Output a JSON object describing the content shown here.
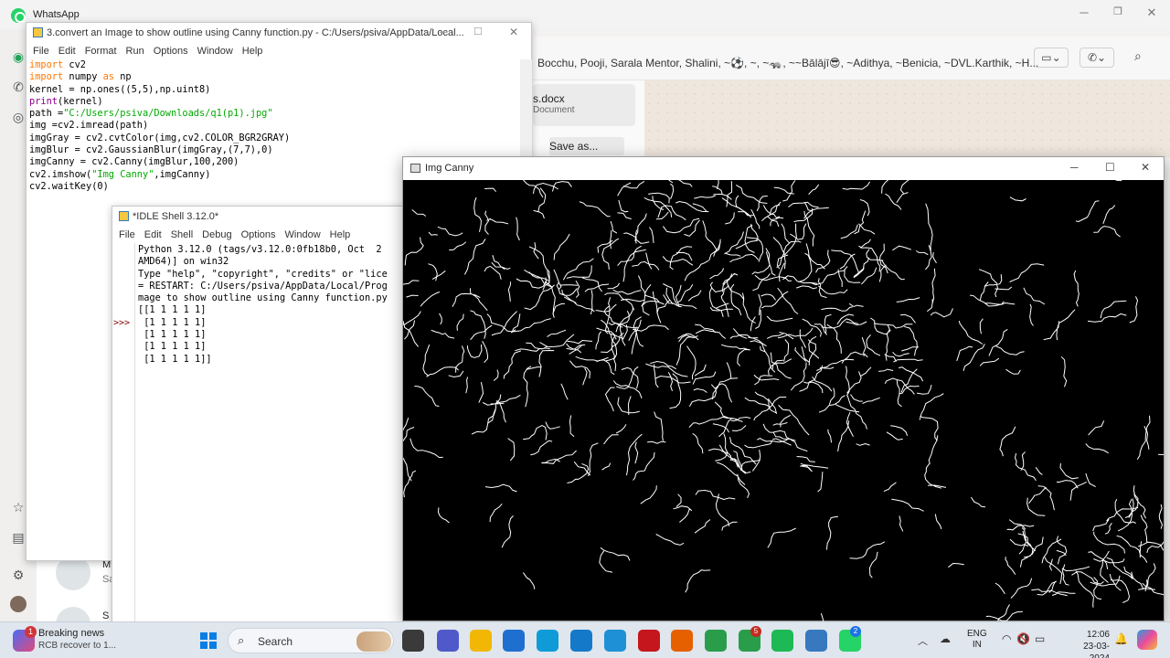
{
  "whatsapp": {
    "app_title": "WhatsApp",
    "group_members": "Bocchu, Pooji, Sarala Mentor, Shalini, ~⚽, ~, ~🦡, ~~Bālājī😎, ~Adithya, ~Benicia, ~DVL.Karthik, ~H...",
    "file_name": "s.docx",
    "file_type": "Document",
    "save_as_label": "Save as...",
    "chat_list_partial": [
      "M",
      "Sa",
      "S"
    ]
  },
  "editor": {
    "title": "3.convert an Image to show outline using Canny function.py - C:/Users/psiva/AppData/Local...",
    "menu": [
      "File",
      "Edit",
      "Format",
      "Run",
      "Options",
      "Window",
      "Help"
    ],
    "code_lines": [
      "import cv2",
      "import numpy as np",
      "kernel = np.ones((5,5),np.uint8)",
      "print(kernel)",
      "path =\"C:/Users/psiva/Downloads/q1(p1).jpg\"",
      "img =cv2.imread(path)",
      "imgGray = cv2.cvtColor(img,cv2.COLOR_BGR2GRAY)",
      "imgBlur = cv2.GaussianBlur(imgGray,(7,7),0)",
      "imgCanny = cv2.Canny(imgBlur,100,200)",
      "cv2.imshow(\"Img Canny\",imgCanny)",
      "cv2.waitKey(0)"
    ]
  },
  "shell": {
    "title": "*IDLE Shell 3.12.0*",
    "menu": [
      "File",
      "Edit",
      "Shell",
      "Debug",
      "Options",
      "Window",
      "Help"
    ],
    "prompt": ">>>",
    "lines": [
      "Python 3.12.0 (tags/v3.12.0:0fb18b0, Oct  2",
      "AMD64)] on win32",
      "Type \"help\", \"copyright\", \"credits\" or \"lice",
      "",
      "= RESTART: C:/Users/psiva/AppData/Local/Prog",
      "mage to show outline using Canny function.py",
      "[[1 1 1 1 1]",
      " [1 1 1 1 1]",
      " [1 1 1 1 1]",
      " [1 1 1 1 1]",
      " [1 1 1 1 1]]"
    ]
  },
  "canny_window": {
    "title": "Img Canny"
  },
  "taskbar": {
    "news_title": "Breaking news",
    "news_subtitle": "RCB recover to 1...",
    "news_badge": "1",
    "search_placeholder": "Search",
    "apps": [
      {
        "name": "file-explorer-dark-icon",
        "color": "#3a3a3a"
      },
      {
        "name": "teams-icon",
        "color": "#5059c9"
      },
      {
        "name": "file-explorer-icon",
        "color": "#f2b705"
      },
      {
        "name": "store-icon",
        "color": "#1f6fd1"
      },
      {
        "name": "edge-icon",
        "color": "#0f9bd7"
      },
      {
        "name": "word-icon",
        "color": "#1e90d6"
      },
      {
        "name": "phone-link-icon",
        "color": "#1479c9"
      },
      {
        "name": "mcafee-icon",
        "color": "#c4161c"
      },
      {
        "name": "firefox-icon",
        "color": "#e66000"
      },
      {
        "name": "chrome-icon",
        "color": "#2a9d4a"
      },
      {
        "name": "chrome-profile-icon",
        "color": "#2a9d4a"
      },
      {
        "name": "spotify-icon",
        "color": "#1db954"
      },
      {
        "name": "idle-icon",
        "color": "#3778bf"
      },
      {
        "name": "whatsapp-icon",
        "color": "#25d366"
      }
    ],
    "chrome_badge": "5",
    "whatsapp_badge": "2",
    "lang_line1": "ENG",
    "lang_line2": "IN",
    "time": "12:06",
    "date": "23-03-2024"
  }
}
